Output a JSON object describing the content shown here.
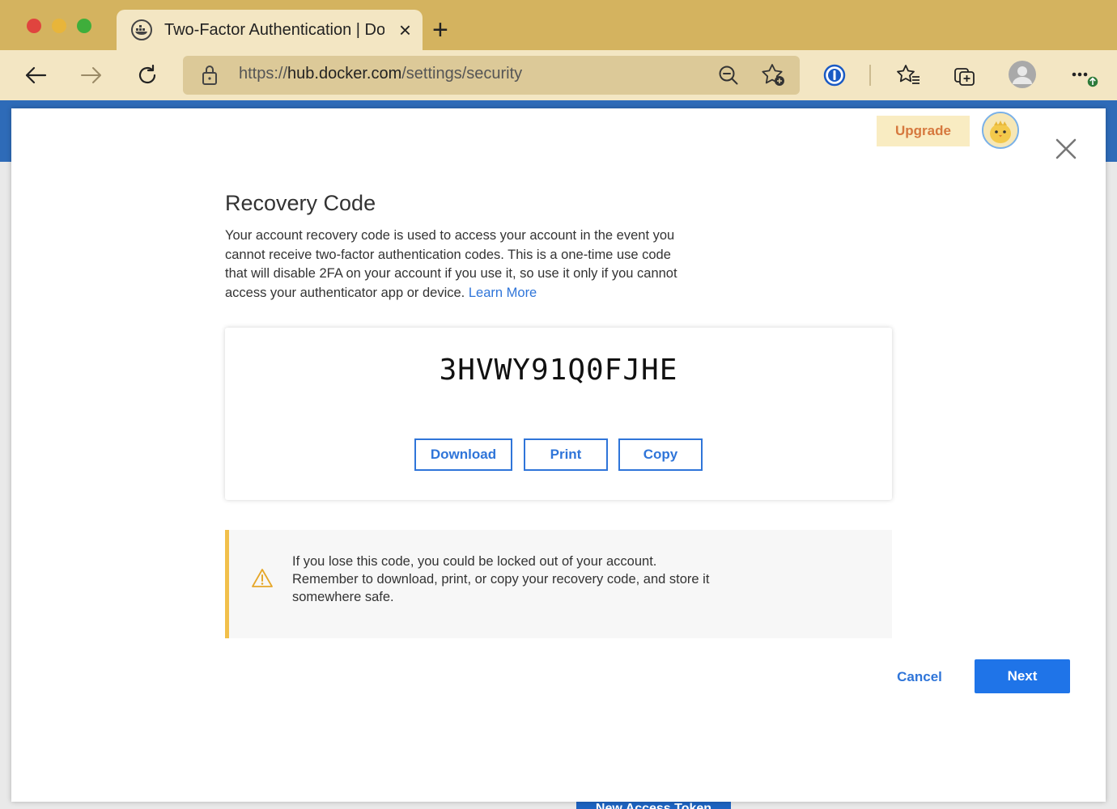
{
  "browser": {
    "tab_title": "Two-Factor Authentication | Docker Hub",
    "url_prefix": "https://",
    "url_host": "hub.docker.com",
    "url_path": "/settings/security"
  },
  "page": {
    "background_button_label": "New Access Token"
  },
  "modal": {
    "upgrade_label": "Upgrade",
    "title": "Recovery Code",
    "description": "Your account recovery code is used to access your account in the event you cannot receive two-factor authentication codes. This is a one-time use code that will disable 2FA on your account if you use it, so use it only if you cannot access your authenticator app or device.",
    "learn_more_label": "Learn More",
    "recovery_code": "3HVWY91Q0FJHE",
    "download_label": "Download",
    "print_label": "Print",
    "copy_label": "Copy",
    "warning_text": "If you lose this code, you could be locked out of your account. Remember to download, print, or copy your recovery code, and store it somewhere safe.",
    "cancel_label": "Cancel",
    "next_label": "Next"
  },
  "colors": {
    "accent_blue": "#1f74e8",
    "link_blue": "#2f75d9",
    "warning_border": "#f1bf4b",
    "upgrade_text": "#d6783e",
    "chrome_tan": "#d4b35f"
  }
}
